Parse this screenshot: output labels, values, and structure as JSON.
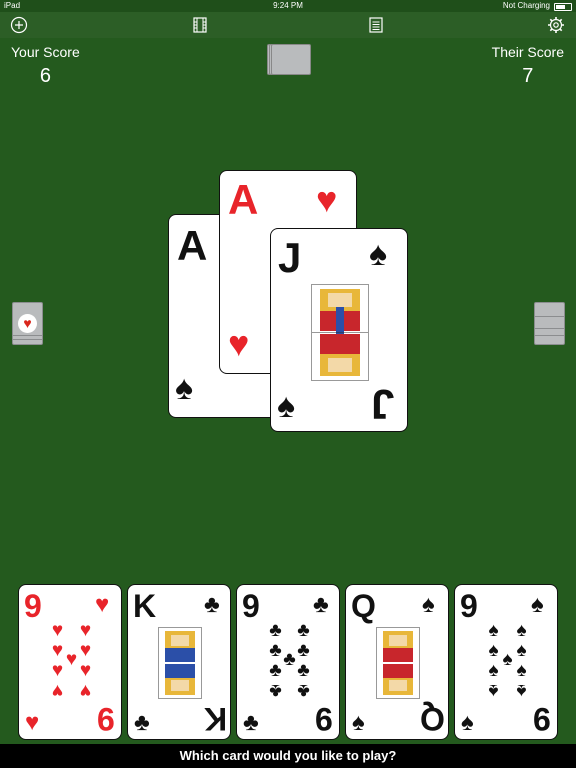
{
  "status_bar": {
    "device": "iPad",
    "time": "9:24 PM",
    "battery_text": "Not Charging"
  },
  "toolbar": {
    "new_game_icon": "plus-circle-icon",
    "film_icon": "film-icon",
    "log_icon": "document-icon",
    "settings_icon": "gear-icon"
  },
  "scores": {
    "your_label": "Your Score",
    "your_value": "6",
    "their_label": "Their Score",
    "their_value": "7"
  },
  "trick": [
    {
      "rank": "A",
      "suit": "♠",
      "color": "black"
    },
    {
      "rank": "A",
      "suit": "♥",
      "color": "red"
    },
    {
      "rank": "J",
      "suit": "♠",
      "color": "black"
    }
  ],
  "trump_indicator_suit": "♥",
  "hand": [
    {
      "rank": "9",
      "suit": "♥",
      "color": "red"
    },
    {
      "rank": "K",
      "suit": "♣",
      "color": "black"
    },
    {
      "rank": "9",
      "suit": "♣",
      "color": "black"
    },
    {
      "rank": "Q",
      "suit": "♠",
      "color": "black"
    },
    {
      "rank": "9",
      "suit": "♠",
      "color": "black"
    }
  ],
  "prompt": "Which card would you like to play?",
  "colors": {
    "felt": "#245a1e",
    "red_suit": "#e8242a"
  }
}
